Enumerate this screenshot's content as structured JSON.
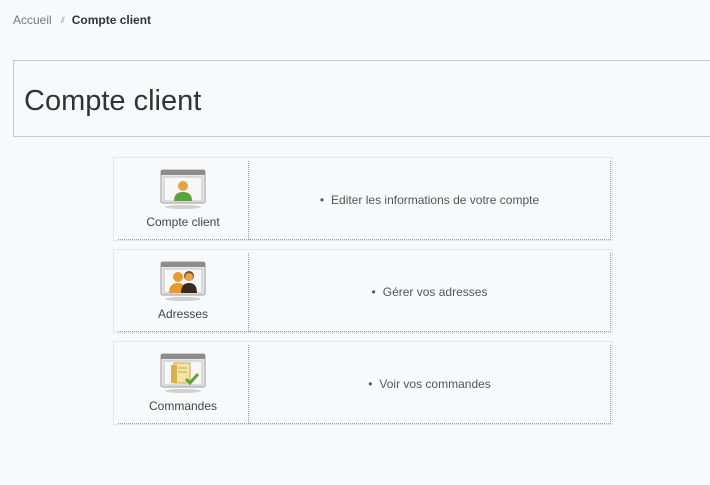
{
  "breadcrumb": {
    "home": "Accueil",
    "separator": "//",
    "current": "Compte client"
  },
  "page": {
    "title": "Compte client"
  },
  "account_items": [
    {
      "label": "Compte client",
      "icon": "user-icon",
      "description": "Editer les informations de votre compte"
    },
    {
      "label": "Adresses",
      "icon": "users-address-icon",
      "description": "Gérer vos adresses"
    },
    {
      "label": "Commandes",
      "icon": "orders-icon",
      "description": "Voir vos commandes"
    }
  ],
  "colors": {
    "background": "#f8f9fb",
    "icon_green": "#5aa33a",
    "icon_orange": "#e89a2c",
    "icon_gold": "#d9b24a"
  }
}
